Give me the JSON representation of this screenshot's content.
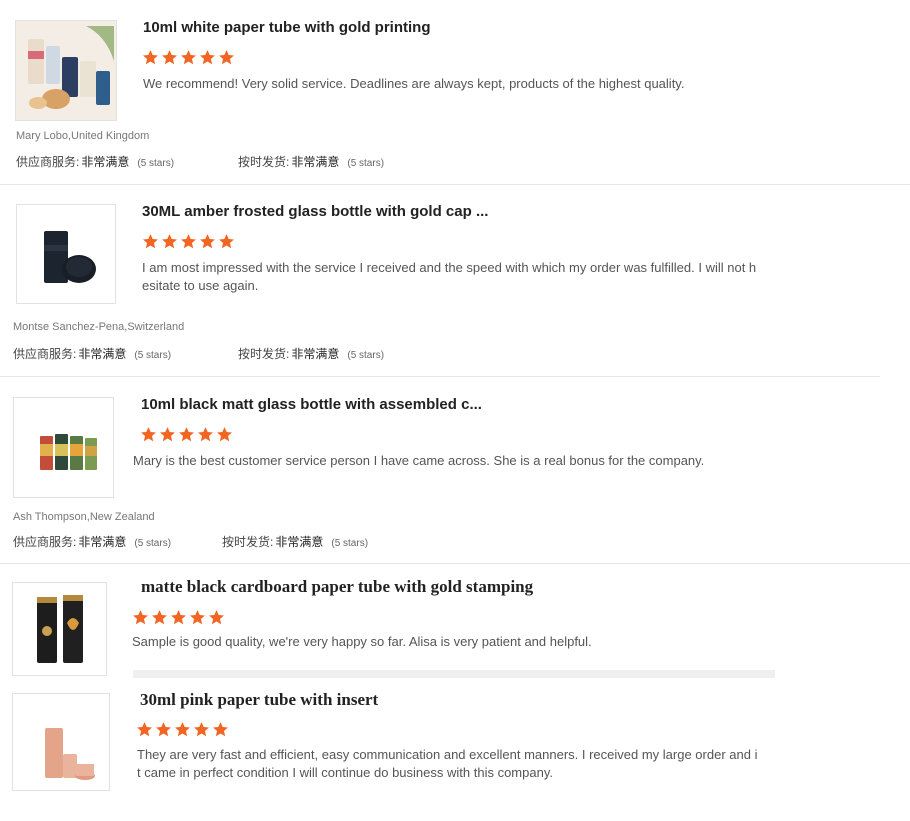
{
  "rating_color": "#f26522",
  "reviews": [
    {
      "title": "10ml white paper tube with gold printing",
      "stars": 5,
      "text_lines": [
        "We recommend! Very solid service. Deadlines are always kept, products of the highest quality."
      ],
      "reviewer": "Mary Lobo,United Kingdom",
      "service_label": "供应商服务:",
      "service_value": "非常满意",
      "service_count": "(5 stars)",
      "delivery_label": "按时发货:",
      "delivery_value": "非常满意",
      "delivery_count": "(5 stars)"
    },
    {
      "title": "30ML amber frosted glass bottle with gold cap ...",
      "stars": 5,
      "text_lines": [
        "I am most impressed with the service I received and the speed with which my order was fulfilled. I will not h",
        "esitate to use again."
      ],
      "reviewer": "Montse Sanchez-Pena,Switzerland",
      "service_label": "供应商服务:",
      "service_value": "非常满意",
      "service_count": "(5 stars)",
      "delivery_label": "按时发货:",
      "delivery_value": "非常满意",
      "delivery_count": "(5 stars)"
    },
    {
      "title": "10ml black matt glass bottle with assembled c...",
      "stars": 5,
      "text_lines": [
        "Mary is the best customer service person I have came across. She is a real bonus for the company."
      ],
      "reviewer": "Ash Thompson,New Zealand",
      "service_label": "供应商服务:",
      "service_value": "非常满意",
      "service_count": "(5 stars)",
      "delivery_label": "按时发货:",
      "delivery_value": "非常满意",
      "delivery_count": "(5 stars)"
    },
    {
      "title": "matte black cardboard paper tube with gold stamping",
      "stars": 5,
      "text_lines": [
        "Sample is good quality, we're very happy so far. Alisa is very patient and helpful."
      ]
    },
    {
      "title": "30ml pink paper tube with insert",
      "stars": 5,
      "text_lines": [
        "They are very fast and efficient, easy communication and excellent manners. I received my large order and i",
        "t came in perfect condition I will continue do business with this company."
      ]
    }
  ]
}
